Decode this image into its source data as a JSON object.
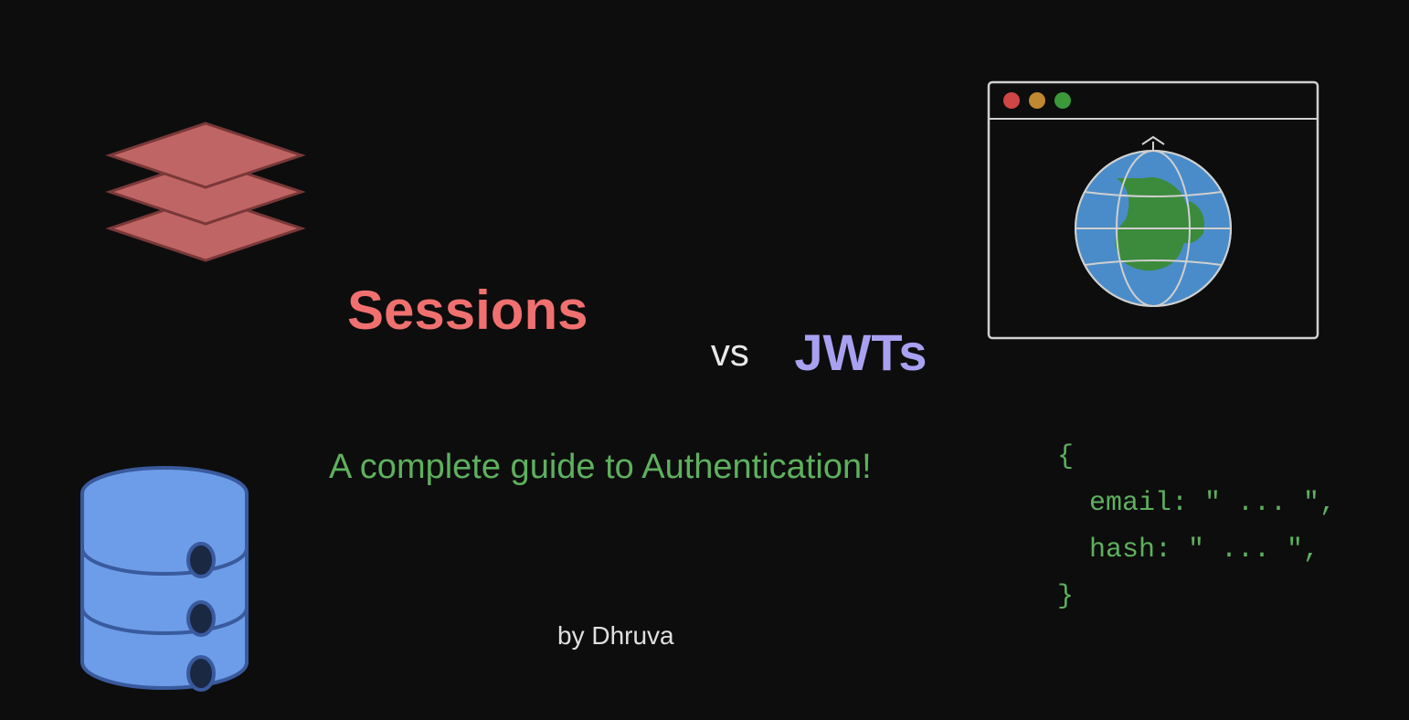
{
  "title": {
    "sessions": "Sessions",
    "vs": "vs",
    "jwts": "JWTs"
  },
  "subtitle": "A complete guide to Authentication!",
  "byline": "by Dhruva",
  "code": {
    "open": "{",
    "line1": "email: \" ... \",",
    "line2": "hash: \" ... \",",
    "close": "}"
  },
  "colors": {
    "sessions": "#f07070",
    "vs": "#e8e8e8",
    "jwts": "#a8a0f0",
    "subtitle": "#5eb05e",
    "code": "#5eb05e",
    "stack_fill": "#c06565",
    "stack_stroke": "#7a3838",
    "db_fill": "#6d9de8",
    "db_stroke": "#3a5a9e",
    "globe_fill": "#4a8cc9",
    "globe_land": "#3c8a3c"
  }
}
